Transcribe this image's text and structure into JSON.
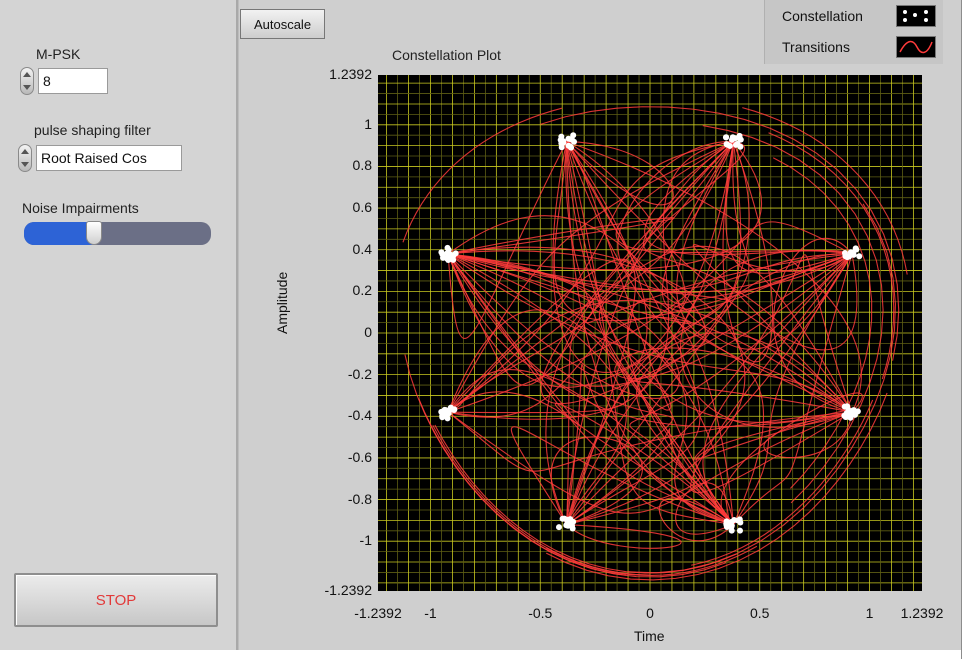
{
  "controls": {
    "mpsk": {
      "label": "M-PSK",
      "value": "8"
    },
    "pulse_filter": {
      "label": "pulse shaping filter",
      "value": "Root Raised Cos"
    },
    "noise": {
      "label": "Noise Impairments",
      "level": 0.33
    },
    "stop_label": "STOP"
  },
  "toolbar": {
    "autoscale_label": "Autoscale"
  },
  "legend": [
    {
      "name": "Constellation",
      "icon": "scatter-points-icon"
    },
    {
      "name": "Transitions",
      "icon": "curve-line-icon"
    }
  ],
  "colors": {
    "plot_background": "#000000",
    "grid": "#c8c820",
    "transitions": "#ff3b3b",
    "points": "#ffffff",
    "slider_fill": "#2d63d6",
    "stop_text": "#e23a3a"
  },
  "chart_data": {
    "type": "scatter",
    "title": "Constellation Plot",
    "xlabel": "Time",
    "ylabel": "Amplitude",
    "xlim": [
      -1.2392,
      1.2392
    ],
    "ylim": [
      -1.2392,
      1.2392
    ],
    "x_ticks": [
      "-1.2392",
      "-1",
      "-0.5",
      "0",
      "0.5",
      "1",
      "1.2392"
    ],
    "y_ticks": [
      "1.2392",
      "1",
      "0.8",
      "0.6",
      "0.4",
      "0.2",
      "0",
      "-0.2",
      "-0.4",
      "-0.6",
      "-0.8",
      "-1",
      "-1.2392"
    ],
    "grid": true,
    "legend_position": "top-right",
    "series": [
      {
        "name": "Constellation",
        "style": "points",
        "points": [
          [
            0.92,
            0.38
          ],
          [
            0.38,
            0.92
          ],
          [
            -0.38,
            0.92
          ],
          [
            -0.92,
            0.38
          ],
          [
            -0.92,
            -0.38
          ],
          [
            -0.38,
            -0.92
          ],
          [
            0.38,
            -0.92
          ],
          [
            0.92,
            -0.38
          ]
        ]
      },
      {
        "name": "Transitions",
        "style": "line"
      }
    ]
  }
}
